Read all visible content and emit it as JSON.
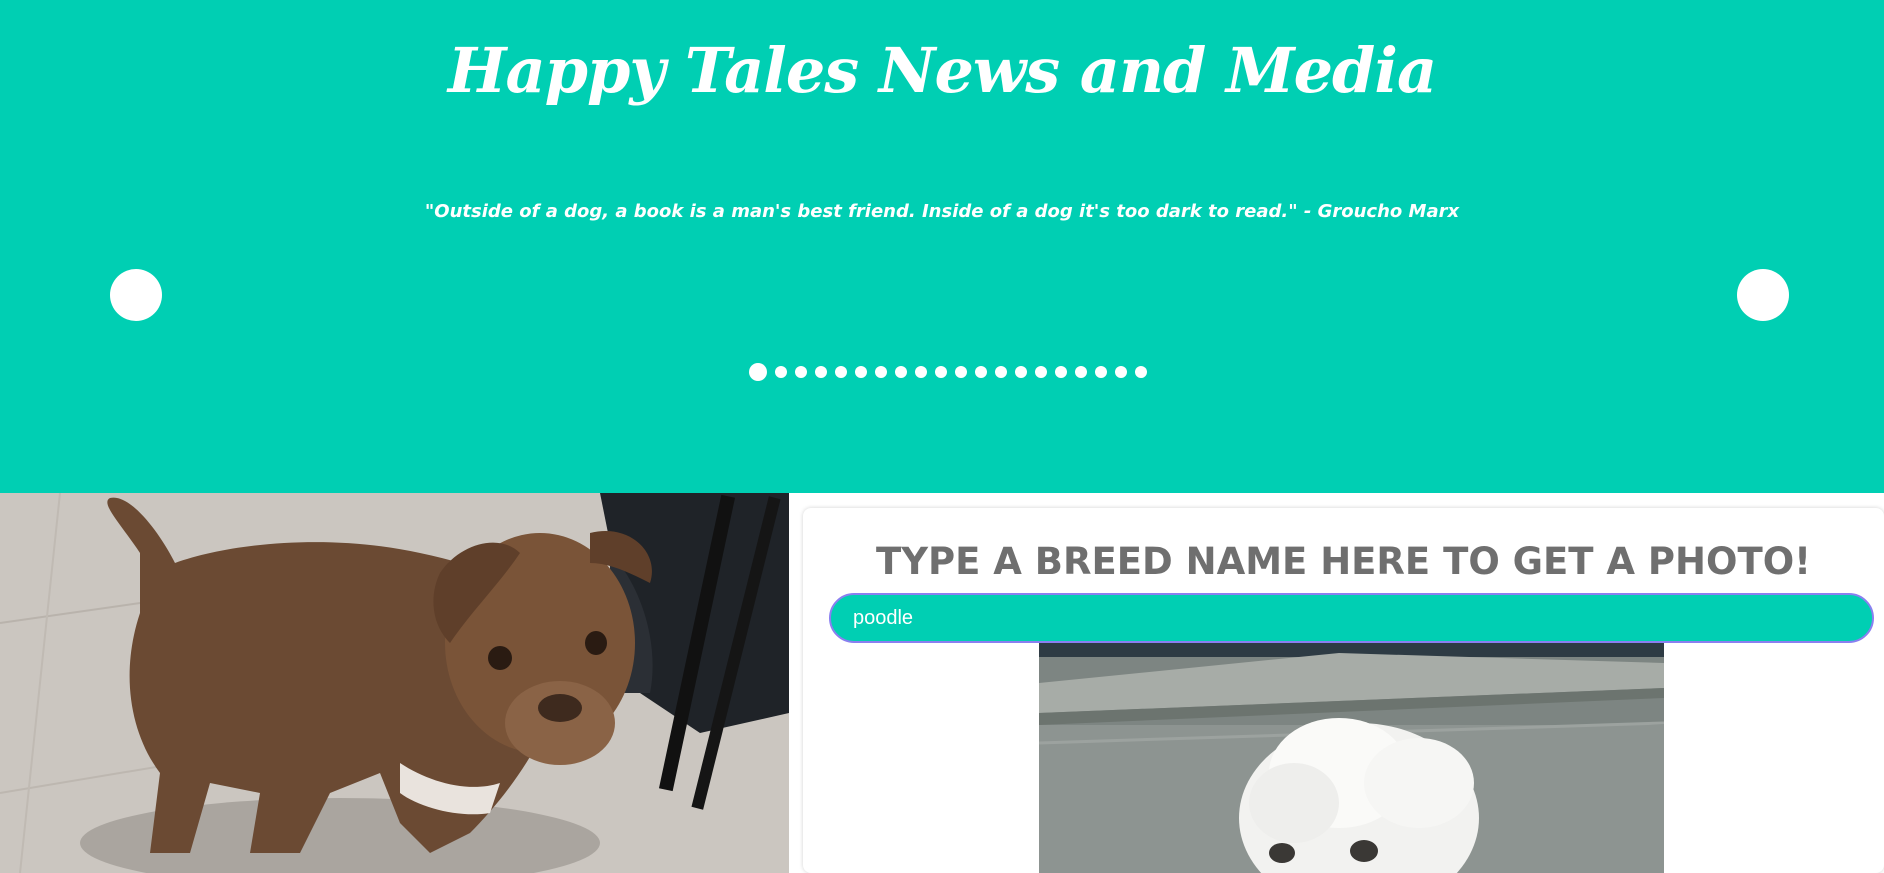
{
  "hero": {
    "title": "Happy Tales News and Media",
    "quote": "\"Outside of a dog, a book is a man's best friend. Inside of a dog it's too dark to read.\" - Groucho Marx",
    "background_color": "#00cfb3",
    "carousel": {
      "prev_icon": "circle-arrow-left-icon",
      "next_icon": "circle-arrow-right-icon",
      "slide_count": 20,
      "active_slide": 1
    }
  },
  "breed_search": {
    "heading": "TYPE A BREED NAME HERE TO GET A PHOTO!",
    "input_value": "poodle"
  }
}
